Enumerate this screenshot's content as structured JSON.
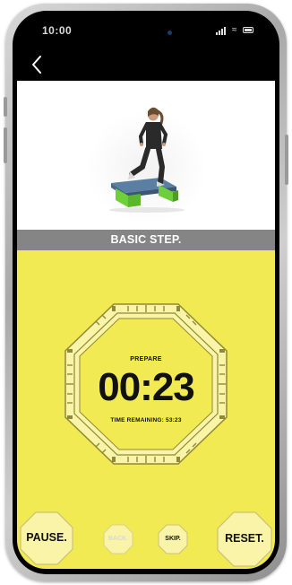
{
  "status_bar": {
    "time": "10:00"
  },
  "nav": {
    "back_icon": "chevron-left-icon"
  },
  "exercise": {
    "title": "BASIC STEP."
  },
  "timer": {
    "phase": "PREPARE",
    "countdown": "00:23",
    "remaining_label": "TIME REMAINING:",
    "remaining_value": "53:23"
  },
  "controls": {
    "pause": "PAUSE.",
    "back": "BACK.",
    "skip": "SKIP.",
    "reset": "RESET."
  },
  "colors": {
    "panel_yellow": "#f2ea52",
    "title_bar_gray": "#858585",
    "button_face": "#faf4a8",
    "disabled_text": "#d8d8d8"
  }
}
